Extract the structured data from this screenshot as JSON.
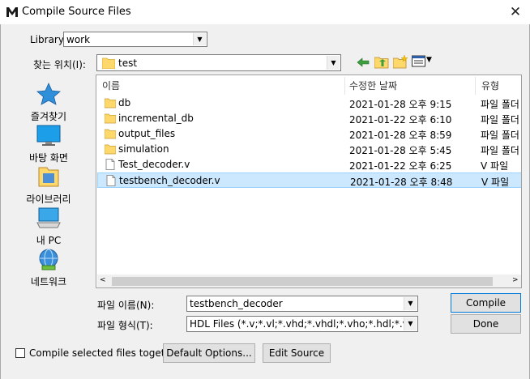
{
  "window": {
    "title": "Compile Source Files",
    "close_glyph": "✕"
  },
  "library": {
    "label": "Library:",
    "value": "work"
  },
  "lookin": {
    "label": "찾는 위치(I):",
    "value": "test"
  },
  "places": [
    {
      "label": "즐겨찾기",
      "icon": "star-icon"
    },
    {
      "label": "바탕 화면",
      "icon": "desktop-icon"
    },
    {
      "label": "라이브러리",
      "icon": "library-icon"
    },
    {
      "label": "내 PC",
      "icon": "computer-icon"
    },
    {
      "label": "네트워크",
      "icon": "network-icon"
    }
  ],
  "columns": {
    "name": "이름",
    "date": "수정한 날짜",
    "type": "유형"
  },
  "files": [
    {
      "name": "db",
      "date": "2021-01-28 오후 9:15",
      "type": "파일 폴더",
      "kind": "folder"
    },
    {
      "name": "incremental_db",
      "date": "2021-01-22 오후 6:10",
      "type": "파일 폴더",
      "kind": "folder"
    },
    {
      "name": "output_files",
      "date": "2021-01-28 오후 8:59",
      "type": "파일 폴더",
      "kind": "folder"
    },
    {
      "name": "simulation",
      "date": "2021-01-28 오후 5:45",
      "type": "파일 폴더",
      "kind": "folder"
    },
    {
      "name": "Test_decoder.v",
      "date": "2021-01-22 오후 6:25",
      "type": "V 파일",
      "kind": "file"
    },
    {
      "name": "testbench_decoder.v",
      "date": "2021-01-28 오후 8:48",
      "type": "V 파일",
      "kind": "file",
      "selected": true
    }
  ],
  "filename": {
    "label": "파일 이름(N):",
    "value": "testbench_decoder"
  },
  "filetype": {
    "label": "파일 형식(T):",
    "value": "HDL Files (*.v;*.vl;*.vhd;*.vhdl;*.vho;*.hdl;*.vo"
  },
  "buttons": {
    "compile": "Compile",
    "done": "Done",
    "default_options": "Default Options...",
    "edit_source": "Edit Source"
  },
  "together": {
    "label": "Compile selected files together",
    "checked": false
  },
  "colors": {
    "selection": "#cce8ff",
    "folder": "#ffd86b",
    "accent": "#0078d7"
  }
}
